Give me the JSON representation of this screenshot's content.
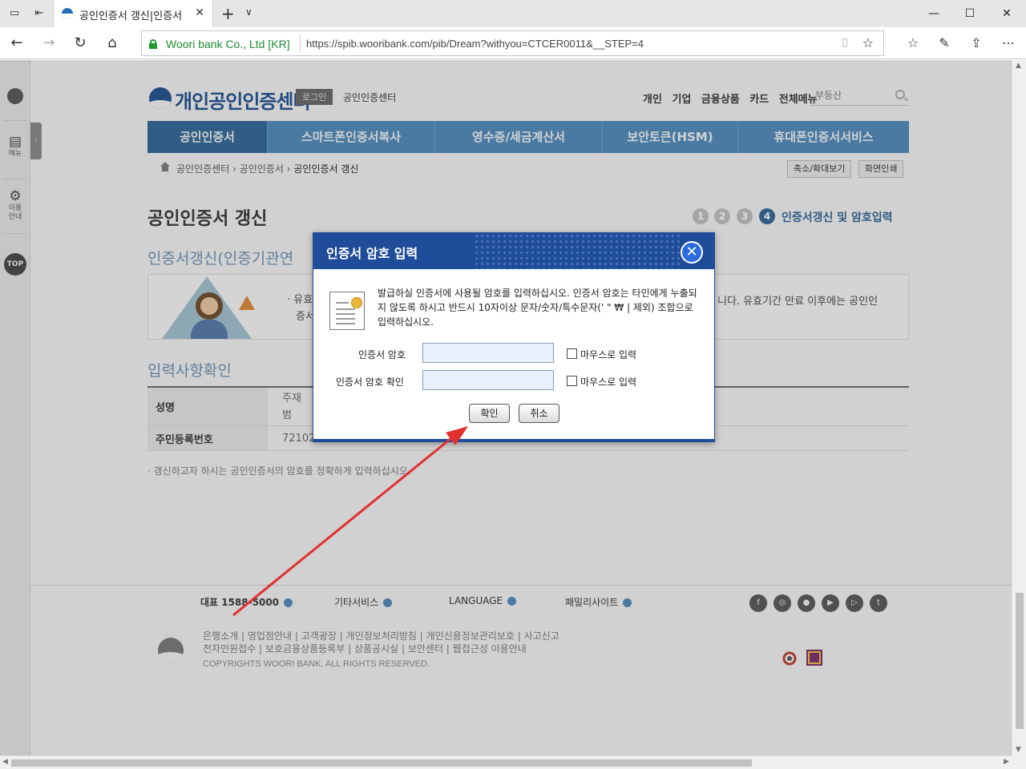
{
  "browser": {
    "tab_title": "공인인증서 갱신|인증서",
    "site_identity": "Woori bank Co., Ltd [KR]",
    "url": "https://spib.wooribank.com/pib/Dream?withyou=CTCER0011&__STEP=4"
  },
  "header": {
    "logo_text": "개인공인인증센터",
    "login_label": "로그인",
    "login_sub": "공인인증센터",
    "top_links": [
      "개인",
      "기업",
      "금융상품",
      "카드",
      "전체메뉴"
    ],
    "search_placeholder": "부동산"
  },
  "sidebar": {
    "menu_label": "메뉴",
    "guide_label": "이용안내",
    "top_label": "TOP"
  },
  "gnb": [
    "공인인증서",
    "스마트폰인증서복사",
    "영수증/세금계산서",
    "보안토큰(HSM)",
    "휴대폰인증서서비스"
  ],
  "breadcrumb": {
    "items": [
      "공인인증센터",
      "공인인증서",
      "공인인증서 갱신"
    ],
    "zoom_button": "축소/확대보기",
    "print_button": "화면인쇄"
  },
  "page": {
    "title": "공인인증서 갱신",
    "steps": [
      "1",
      "2",
      "3",
      "4"
    ],
    "current_step_label": "인증서갱신 및 암호입력",
    "section1_title": "인증서갱신(인증기관연",
    "info_text_left": "· 유효",
    "info_text_left2": "증서",
    "info_text_right": "니다. 유효기간 만료 이후에는 공인인",
    "section2_title": "입력사항확인",
    "table": [
      {
        "label": "성명",
        "value": "주재\n범"
      },
      {
        "label": "주민등록번호",
        "value": "721020 -"
      }
    ],
    "note": "· 갱신하고자 하시는 공인인증서의 암호를 정확하게 입력하십시오."
  },
  "footer": {
    "menus": [
      "대표 1588-5000",
      "기타서비스",
      "LANGUAGE",
      "패밀리사이트"
    ],
    "links_line1": "은행소개 | 영업점안내 | 고객광장 | 개인정보처리방침 | 개인신용정보관리보호 | 사고신고",
    "links_line2": "전자민원접수 | 보호금융상품등록부 | 상품공시실 | 보안센터 | 웹접근성 이용안내",
    "copyright": "COPYRIGHTS WOORI BANK. ALL RIGHTS RESERVED."
  },
  "modal": {
    "title": "인증서 암호 입력",
    "message": "발급하실 인증서에 사용될 암호를 입력하십시오. 인증서 암호는 타인에게 누출되지 않도록 하시고 반드시 10자이상 문자/숫자/특수문자(' \" ₩ | 제외) 조합으로 입력하십시오.",
    "password_label": "인증서 암호",
    "confirm_label": "인증서 암호 확인",
    "mouse_input_label": "마우스로 입력",
    "ok_button": "확인",
    "cancel_button": "취소"
  },
  "colors": {
    "accent": "#1f4d9a",
    "annotation_arrow": "#e03030"
  }
}
